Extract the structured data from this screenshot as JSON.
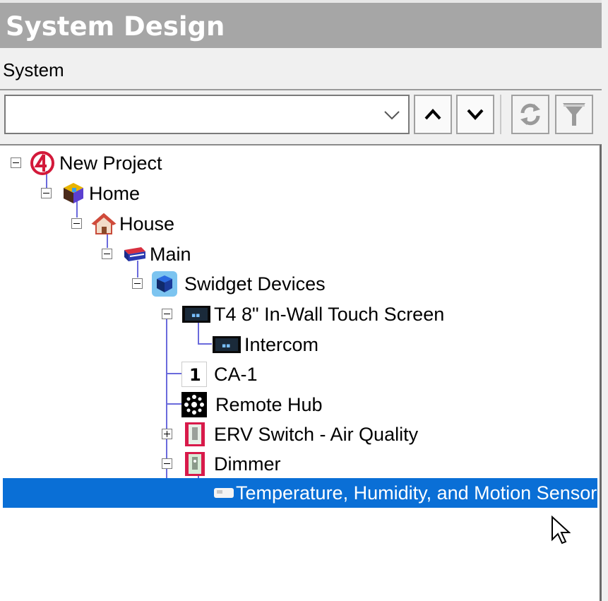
{
  "panel": {
    "title": "System Design",
    "tab": "System"
  },
  "toolbar": {
    "combo_value": "",
    "buttons": [
      "move-up",
      "move-down",
      "refresh",
      "filter"
    ]
  },
  "tree": {
    "nodes": [
      {
        "label": "New Project",
        "icon": "project-logo-icon",
        "expanded": true
      },
      {
        "label": "Home",
        "icon": "home-site-icon",
        "expanded": true
      },
      {
        "label": "House",
        "icon": "house-icon",
        "expanded": true
      },
      {
        "label": "Main",
        "icon": "floor-icon",
        "expanded": true
      },
      {
        "label": "Swidget Devices",
        "icon": "device-folder-icon",
        "expanded": true
      },
      {
        "label": "T4 8\" In-Wall Touch Screen",
        "icon": "touch-screen-icon",
        "expanded": true
      },
      {
        "label": "Intercom",
        "icon": "intercom-icon"
      },
      {
        "label": "CA-1",
        "icon": "controller-one-icon"
      },
      {
        "label": "Remote Hub",
        "icon": "hub-icon"
      },
      {
        "label": "ERV Switch - Air Quality",
        "icon": "switch-icon",
        "expanded": false
      },
      {
        "label": "Dimmer",
        "icon": "dimmer-icon",
        "expanded": true
      },
      {
        "label": "Temperature, Humidity, and Motion Sensor",
        "icon": "sensor-icon",
        "selected": true
      }
    ]
  },
  "colors": {
    "title_bar": "#a6a6a6",
    "selection": "#0a6fd6",
    "tree_lines": "#6a6adc"
  }
}
